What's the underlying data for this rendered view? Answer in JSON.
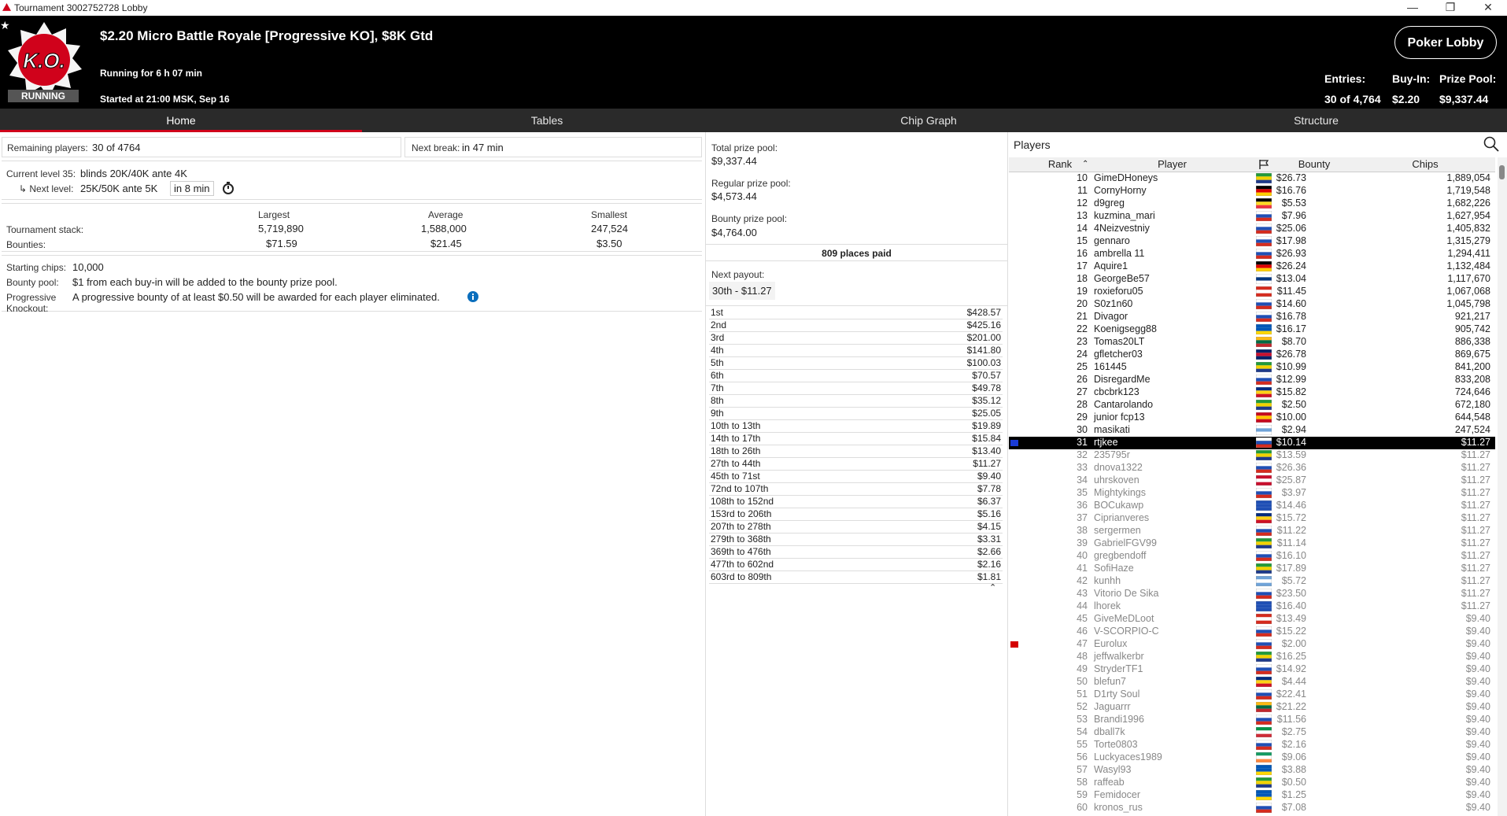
{
  "window": {
    "title": "Tournament 3002752728 Lobby",
    "controls": [
      "—",
      "❐",
      "✕"
    ]
  },
  "header": {
    "title": "$2.20 Micro Battle Royale [Progressive KO], $8K Gtd",
    "running_for": "Running for 6 h 07 min",
    "started_at": "Started at 21:00 MSK, Sep 16",
    "status_badge": "RUNNING",
    "logo_text": "K.O.",
    "poker_lobby_button": "Poker Lobby",
    "stats": {
      "entries_label": "Entries:",
      "entries_value": "30 of 4,764",
      "buyin_label": "Buy-In:",
      "buyin_value": "$2.20",
      "prizepool_label": "Prize Pool:",
      "prizepool_value": "$9,337.44"
    },
    "accent_color": "#d0021b"
  },
  "tabs": [
    {
      "label": "Home",
      "active": true
    },
    {
      "label": "Tables",
      "active": false
    },
    {
      "label": "Chip Graph",
      "active": false
    },
    {
      "label": "Structure",
      "active": false
    }
  ],
  "home": {
    "remaining_label": "Remaining players:",
    "remaining_value": "30 of 4764",
    "next_break_label": "Next break:",
    "next_break_value": "in 47 min",
    "current_level_label": "Current level 35:",
    "current_level_value": "blinds 20K/40K ante 4K",
    "next_level_label": "↳ Next level:",
    "next_level_value": "25K/50K ante 5K",
    "next_level_time": "in 8 min",
    "stats_headers": {
      "largest": "Largest",
      "average": "Average",
      "smallest": "Smallest"
    },
    "stack_label": "Tournament stack:",
    "stack_largest": "5,719,890",
    "stack_average": "1,588,000",
    "stack_smallest": "247,524",
    "bounties_label": "Bounties:",
    "bounty_largest": "$71.59",
    "bounty_average": "$21.45",
    "bounty_smallest": "$3.50",
    "starting_chips_label": "Starting chips:",
    "starting_chips_value": "10,000",
    "bounty_pool_label": "Bounty pool:",
    "bounty_pool_value": "$1 from each buy-in will be added to the bounty prize pool.",
    "progressive_label_1": "Progressive",
    "progressive_label_2": "Knockout:",
    "progressive_value": "A progressive bounty of at least $0.50 will be awarded for each player eliminated."
  },
  "prizes": {
    "total_label": "Total prize pool:",
    "total_value": "$9,337.44",
    "regular_label": "Regular prize pool:",
    "regular_value": "$4,573.44",
    "bounty_label": "Bounty prize pool:",
    "bounty_value": "$4,764.00",
    "places_paid": "809 places paid",
    "next_payout_label": "Next payout:",
    "next_payout_value": "30th - $11.27",
    "payouts": [
      {
        "place": "1st",
        "amount": "$428.57"
      },
      {
        "place": "2nd",
        "amount": "$425.16"
      },
      {
        "place": "3rd",
        "amount": "$201.00"
      },
      {
        "place": "4th",
        "amount": "$141.80"
      },
      {
        "place": "5th",
        "amount": "$100.03"
      },
      {
        "place": "6th",
        "amount": "$70.57"
      },
      {
        "place": "7th",
        "amount": "$49.78"
      },
      {
        "place": "8th",
        "amount": "$35.12"
      },
      {
        "place": "9th",
        "amount": "$25.05"
      },
      {
        "place": "10th to 13th",
        "amount": "$19.89"
      },
      {
        "place": "14th to 17th",
        "amount": "$15.84"
      },
      {
        "place": "18th to 26th",
        "amount": "$13.40"
      },
      {
        "place": "27th to 44th",
        "amount": "$11.27"
      },
      {
        "place": "45th to 71st",
        "amount": "$9.40"
      },
      {
        "place": "72nd to 107th",
        "amount": "$7.78"
      },
      {
        "place": "108th to 152nd",
        "amount": "$6.37"
      },
      {
        "place": "153rd to 206th",
        "amount": "$5.16"
      },
      {
        "place": "207th to 278th",
        "amount": "$4.15"
      },
      {
        "place": "279th to 368th",
        "amount": "$3.31"
      },
      {
        "place": "369th to 476th",
        "amount": "$2.66"
      },
      {
        "place": "477th to 602nd",
        "amount": "$2.16"
      },
      {
        "place": "603rd to 809th",
        "amount": "$1.81"
      }
    ]
  },
  "players": {
    "title": "Players",
    "columns": {
      "rank": "Rank",
      "player": "Player",
      "bounty": "Bounty",
      "chips": "Chips"
    },
    "rows": [
      {
        "rank": "10",
        "name": "GimeDHoneys",
        "bounty": "$26.73",
        "chips": "1,889,054",
        "flag": [
          "#229a3a",
          "#f2d200",
          "#1e3a8a"
        ],
        "state": "normal"
      },
      {
        "rank": "11",
        "name": "CornyHorny",
        "bounty": "$16.76",
        "chips": "1,719,548",
        "flag": [
          "#000000",
          "#dd0000",
          "#ffce00"
        ],
        "state": "normal"
      },
      {
        "rank": "12",
        "name": "d9greg",
        "bounty": "$5.53",
        "chips": "1,682,226",
        "flag": [
          "#000000",
          "#fdda24",
          "#ef3340"
        ],
        "state": "normal"
      },
      {
        "rank": "13",
        "name": "kuzmina_mari",
        "bounty": "$7.96",
        "chips": "1,627,954",
        "flag": [
          "#ffffff",
          "#1f4fb5",
          "#d52b1e"
        ],
        "state": "normal"
      },
      {
        "rank": "14",
        "name": "4Neizvestniy",
        "bounty": "$25.06",
        "chips": "1,405,832",
        "flag": [
          "#ffffff",
          "#1f4fb5",
          "#d52b1e"
        ],
        "state": "normal"
      },
      {
        "rank": "15",
        "name": "gennaro",
        "bounty": "$17.98",
        "chips": "1,315,279",
        "flag": [
          "#ffffff",
          "#1f4fb5",
          "#d52b1e"
        ],
        "state": "normal"
      },
      {
        "rank": "16",
        "name": "ambrella 11",
        "bounty": "$26.93",
        "chips": "1,294,411",
        "flag": [
          "#ffffff",
          "#1f4fb5",
          "#d52b1e"
        ],
        "state": "normal"
      },
      {
        "rank": "17",
        "name": "Aquire1",
        "bounty": "$26.24",
        "chips": "1,132,484",
        "flag": [
          "#000000",
          "#dd0000",
          "#ffce00"
        ],
        "state": "normal"
      },
      {
        "rank": "18",
        "name": "GeorgeBe57",
        "bounty": "$13.04",
        "chips": "1,117,670",
        "flag": [
          "#ffffff",
          "#003580",
          "#ffffff"
        ],
        "state": "normal"
      },
      {
        "rank": "19",
        "name": "roxieforu05",
        "bounty": "$11.45",
        "chips": "1,067,068",
        "flag": [
          "#d52b1e",
          "#ffffff",
          "#d52b1e"
        ],
        "state": "normal"
      },
      {
        "rank": "20",
        "name": "S0z1n60",
        "bounty": "$14.60",
        "chips": "1,045,798",
        "flag": [
          "#ffffff",
          "#1f4fb5",
          "#d52b1e"
        ],
        "state": "normal"
      },
      {
        "rank": "21",
        "name": "Divagor",
        "bounty": "$16.78",
        "chips": "921,217",
        "flag": [
          "#ffffff",
          "#1f4fb5",
          "#d52b1e"
        ],
        "state": "normal"
      },
      {
        "rank": "22",
        "name": "Koenigsegg88",
        "bounty": "$16.17",
        "chips": "905,742",
        "flag": [
          "#0057b7",
          "#0057b7",
          "#ffd700"
        ],
        "state": "normal"
      },
      {
        "rank": "23",
        "name": "Tomas20LT",
        "bounty": "$8.70",
        "chips": "886,338",
        "flag": [
          "#fdb913",
          "#006a44",
          "#c1272d"
        ],
        "state": "normal"
      },
      {
        "rank": "24",
        "name": "gfletcher03",
        "bounty": "$26.78",
        "chips": "869,675",
        "flag": [
          "#012169",
          "#c8102e",
          "#012169"
        ],
        "state": "normal"
      },
      {
        "rank": "25",
        "name": "161445",
        "bounty": "$10.99",
        "chips": "841,200",
        "flag": [
          "#229a3a",
          "#f2d200",
          "#1e3a8a"
        ],
        "state": "normal"
      },
      {
        "rank": "26",
        "name": "DisregardMe",
        "bounty": "$12.99",
        "chips": "833,208",
        "flag": [
          "#ffffff",
          "#1f4fb5",
          "#d52b1e"
        ],
        "state": "normal"
      },
      {
        "rank": "27",
        "name": "cbcbrk123",
        "bounty": "$15.82",
        "chips": "724,646",
        "flag": [
          "#002b7f",
          "#fcd116",
          "#ce1126"
        ],
        "state": "normal"
      },
      {
        "rank": "28",
        "name": "Cantarolando",
        "bounty": "$2.50",
        "chips": "672,180",
        "flag": [
          "#229a3a",
          "#f2d200",
          "#1e3a8a"
        ],
        "state": "normal"
      },
      {
        "rank": "29",
        "name": "junior fcp13",
        "bounty": "$10.00",
        "chips": "644,548",
        "flag": [
          "#c60b1e",
          "#ffc400",
          "#c60b1e"
        ],
        "state": "normal"
      },
      {
        "rank": "30",
        "name": "masikati",
        "bounty": "$2.94",
        "chips": "247,524",
        "flag": [
          "#ffffff",
          "#6fa3d8",
          "#ffffff"
        ],
        "state": "normal"
      },
      {
        "rank": "31",
        "name": "rtjkee",
        "bounty": "$10.14",
        "chips": "$11.27",
        "flag": [
          "#ffffff",
          "#1f4fb5",
          "#d52b1e"
        ],
        "state": "highlight",
        "marker": "#1a3bd6"
      },
      {
        "rank": "32",
        "name": "235795r",
        "bounty": "$13.59",
        "chips": "$11.27",
        "flag": [
          "#229a3a",
          "#f2d200",
          "#1e3a8a"
        ],
        "state": "dim"
      },
      {
        "rank": "33",
        "name": "dnova1322",
        "bounty": "$26.36",
        "chips": "$11.27",
        "flag": [
          "#ffffff",
          "#1f4fb5",
          "#d52b1e"
        ],
        "state": "dim"
      },
      {
        "rank": "34",
        "name": "uhrskoven",
        "bounty": "$25.87",
        "chips": "$11.27",
        "flag": [
          "#c8102e",
          "#ffffff",
          "#c8102e"
        ],
        "state": "dim"
      },
      {
        "rank": "35",
        "name": "Mightykings",
        "bounty": "$3.97",
        "chips": "$11.27",
        "flag": [
          "#ffffff",
          "#1f4fb5",
          "#d52b1e"
        ],
        "state": "dim"
      },
      {
        "rank": "36",
        "name": "BOCukawp",
        "bounty": "$14.46",
        "chips": "$11.27",
        "flag": [
          "#1f4fb5",
          "#1f4fb5",
          "#1f4fb5"
        ],
        "state": "dim"
      },
      {
        "rank": "37",
        "name": "Ciprianveres",
        "bounty": "$15.72",
        "chips": "$11.27",
        "flag": [
          "#002b7f",
          "#fcd116",
          "#ce1126"
        ],
        "state": "dim"
      },
      {
        "rank": "38",
        "name": "sergermen",
        "bounty": "$11.22",
        "chips": "$11.27",
        "flag": [
          "#ffffff",
          "#1f4fb5",
          "#d52b1e"
        ],
        "state": "dim"
      },
      {
        "rank": "39",
        "name": "GabrielFGV99",
        "bounty": "$11.14",
        "chips": "$11.27",
        "flag": [
          "#229a3a",
          "#f2d200",
          "#1e3a8a"
        ],
        "state": "dim"
      },
      {
        "rank": "40",
        "name": "gregbendoff",
        "bounty": "$16.10",
        "chips": "$11.27",
        "flag": [
          "#ffffff",
          "#1f4fb5",
          "#d52b1e"
        ],
        "state": "dim"
      },
      {
        "rank": "41",
        "name": "SofiHaze",
        "bounty": "$17.89",
        "chips": "$11.27",
        "flag": [
          "#229a3a",
          "#f2d200",
          "#1e3a8a"
        ],
        "state": "dim"
      },
      {
        "rank": "42",
        "name": "kunhh",
        "bounty": "$5.72",
        "chips": "$11.27",
        "flag": [
          "#6fa3d8",
          "#ffffff",
          "#6fa3d8"
        ],
        "state": "dim"
      },
      {
        "rank": "43",
        "name": "Vitorio De Sika",
        "bounty": "$23.50",
        "chips": "$11.27",
        "flag": [
          "#ffffff",
          "#1f4fb5",
          "#d52b1e"
        ],
        "state": "dim"
      },
      {
        "rank": "44",
        "name": "lhorek",
        "bounty": "$16.40",
        "chips": "$11.27",
        "flag": [
          "#1f4fb5",
          "#1f4fb5",
          "#1f4fb5"
        ],
        "state": "dim"
      },
      {
        "rank": "45",
        "name": "GiveMeDLoot",
        "bounty": "$13.49",
        "chips": "$9.40",
        "flag": [
          "#d52b1e",
          "#ffffff",
          "#d52b1e"
        ],
        "state": "dim"
      },
      {
        "rank": "46",
        "name": "V-SCORPIO-C",
        "bounty": "$15.22",
        "chips": "$9.40",
        "flag": [
          "#ffffff",
          "#1f4fb5",
          "#d52b1e"
        ],
        "state": "dim"
      },
      {
        "rank": "47",
        "name": "Eurolux",
        "bounty": "$2.00",
        "chips": "$9.40",
        "flag": [
          "#ffffff",
          "#1f4fb5",
          "#d52b1e"
        ],
        "state": "dim",
        "marker": "#d40000"
      },
      {
        "rank": "48",
        "name": "jeffwalkerbr",
        "bounty": "$16.25",
        "chips": "$9.40",
        "flag": [
          "#229a3a",
          "#f2d200",
          "#1e3a8a"
        ],
        "state": "dim"
      },
      {
        "rank": "49",
        "name": "StryderTF1",
        "bounty": "$14.92",
        "chips": "$9.40",
        "flag": [
          "#ffffff",
          "#1f4fb5",
          "#d52b1e"
        ],
        "state": "dim"
      },
      {
        "rank": "50",
        "name": "blefun7",
        "bounty": "$4.44",
        "chips": "$9.40",
        "flag": [
          "#002b7f",
          "#fcd116",
          "#ce1126"
        ],
        "state": "dim"
      },
      {
        "rank": "51",
        "name": "D1rty Soul",
        "bounty": "$22.41",
        "chips": "$9.40",
        "flag": [
          "#ffffff",
          "#1f4fb5",
          "#d52b1e"
        ],
        "state": "dim"
      },
      {
        "rank": "52",
        "name": "Jaguarrr",
        "bounty": "$21.22",
        "chips": "$9.40",
        "flag": [
          "#fdb913",
          "#006a44",
          "#c1272d"
        ],
        "state": "dim"
      },
      {
        "rank": "53",
        "name": "Brandi1996",
        "bounty": "$11.56",
        "chips": "$9.40",
        "flag": [
          "#ffffff",
          "#1f4fb5",
          "#d52b1e"
        ],
        "state": "dim"
      },
      {
        "rank": "54",
        "name": "dball7k",
        "bounty": "$2.75",
        "chips": "$9.40",
        "flag": [
          "#009246",
          "#ffffff",
          "#ce2b37"
        ],
        "state": "dim"
      },
      {
        "rank": "55",
        "name": "Torte0803",
        "bounty": "$2.16",
        "chips": "$9.40",
        "flag": [
          "#ffffff",
          "#1f4fb5",
          "#d52b1e"
        ],
        "state": "dim"
      },
      {
        "rank": "56",
        "name": "Luckyaces1989",
        "bounty": "$9.06",
        "chips": "$9.40",
        "flag": [
          "#169b62",
          "#ffffff",
          "#ff883e"
        ],
        "state": "dim"
      },
      {
        "rank": "57",
        "name": "Wasyl93",
        "bounty": "$3.88",
        "chips": "$9.40",
        "flag": [
          "#0057b7",
          "#0057b7",
          "#ffd700"
        ],
        "state": "dim"
      },
      {
        "rank": "58",
        "name": "raffeab",
        "bounty": "$0.50",
        "chips": "$9.40",
        "flag": [
          "#229a3a",
          "#f2d200",
          "#1e3a8a"
        ],
        "state": "dim"
      },
      {
        "rank": "59",
        "name": "Femidocer",
        "bounty": "$1.25",
        "chips": "$9.40",
        "flag": [
          "#0057b7",
          "#0057b7",
          "#ffd700"
        ],
        "state": "dim"
      },
      {
        "rank": "60",
        "name": "kronos_rus",
        "bounty": "$7.08",
        "chips": "$9.40",
        "flag": [
          "#ffffff",
          "#1f4fb5",
          "#d52b1e"
        ],
        "state": "dim"
      }
    ]
  }
}
